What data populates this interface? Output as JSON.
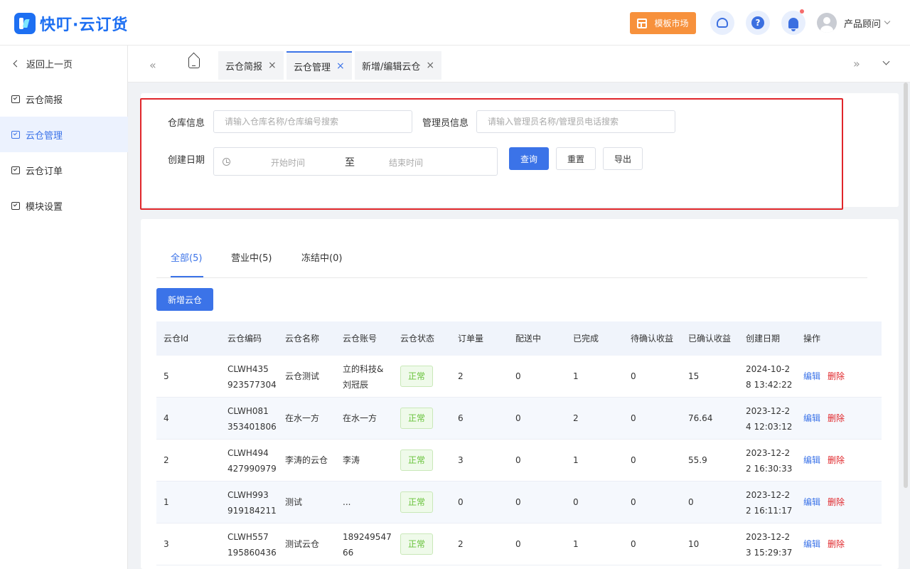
{
  "header": {
    "logo_text": "快叮·云订货",
    "market_label": "模板市场",
    "help_glyph": "?",
    "user_name": "产品顾问"
  },
  "sidebar": {
    "back_label": "返回上一页",
    "items": [
      {
        "label": "云仓简报",
        "active": false
      },
      {
        "label": "云仓管理",
        "active": true
      },
      {
        "label": "云仓订单",
        "active": false
      },
      {
        "label": "模块设置",
        "active": false
      }
    ]
  },
  "tabbar": {
    "left_glyph": "«",
    "right_glyph": "»",
    "close_glyph": "×",
    "tabs": [
      {
        "label": "云仓简报",
        "active": false
      },
      {
        "label": "云仓管理",
        "active": true
      },
      {
        "label": "新增/编辑云仓",
        "active": false
      }
    ]
  },
  "filter": {
    "warehouse_label": "仓库信息",
    "warehouse_placeholder": "请输入仓库名称/仓库编号搜索",
    "manager_label": "管理员信息",
    "manager_placeholder": "请输入管理员名称/管理员电话搜索",
    "date_label": "创建日期",
    "date_start": "开始时间",
    "date_sep": "至",
    "date_end": "结束时间",
    "query_label": "查询",
    "reset_label": "重置",
    "export_label": "导出"
  },
  "list": {
    "tabs": [
      "全部(5)",
      "营业中(5)",
      "冻结中(0)"
    ],
    "add_label": "新增云仓",
    "columns": [
      "云仓Id",
      "云仓编码",
      "云仓名称",
      "云仓账号",
      "云仓状态",
      "订单量",
      "配送中",
      "已完成",
      "待确认收益",
      "已确认收益",
      "创建日期",
      "操作"
    ],
    "edit_label": "编辑",
    "delete_label": "删除",
    "rows": [
      {
        "id": "5",
        "code1": "CLWH435",
        "code2": "923577304",
        "name": "云仓测试",
        "acct1": "立的科技&",
        "acct2": "刘冠辰",
        "status": "正常",
        "orders": "2",
        "delivering": "0",
        "completed": "1",
        "pending": "0",
        "confirmed": "15",
        "date1": "2024-10-2",
        "date2": "8 13:42:22"
      },
      {
        "id": "4",
        "code1": "CLWH081",
        "code2": "353401806",
        "name": "在水一方",
        "acct1": "在水一方",
        "acct2": "",
        "status": "正常",
        "orders": "6",
        "delivering": "0",
        "completed": "2",
        "pending": "0",
        "confirmed": "76.64",
        "date1": "2023-12-2",
        "date2": "4 12:03:12"
      },
      {
        "id": "2",
        "code1": "CLWH494",
        "code2": "427990979",
        "name": "李涛的云仓",
        "acct1": "李涛",
        "acct2": "",
        "status": "正常",
        "orders": "3",
        "delivering": "0",
        "completed": "1",
        "pending": "0",
        "confirmed": "55.9",
        "date1": "2023-12-2",
        "date2": "2 16:30:33"
      },
      {
        "id": "1",
        "code1": "CLWH993",
        "code2": "919184211",
        "name": "测试",
        "acct1": "...",
        "acct2": "",
        "status": "正常",
        "orders": "0",
        "delivering": "0",
        "completed": "0",
        "pending": "0",
        "confirmed": "0",
        "date1": "2023-12-2",
        "date2": "2 16:11:17"
      },
      {
        "id": "3",
        "code1": "CLWH557",
        "code2": "195860436",
        "name": "测试云仓",
        "acct1": "189249547",
        "acct2": "66",
        "status": "正常",
        "orders": "2",
        "delivering": "0",
        "completed": "1",
        "pending": "0",
        "confirmed": "10",
        "date1": "2023-12-2",
        "date2": "3 15:29:37"
      }
    ]
  },
  "colors": {
    "accent": "#3b73e8",
    "market": "#f7913c",
    "danger": "#e0262a",
    "success": "#67c23a"
  }
}
